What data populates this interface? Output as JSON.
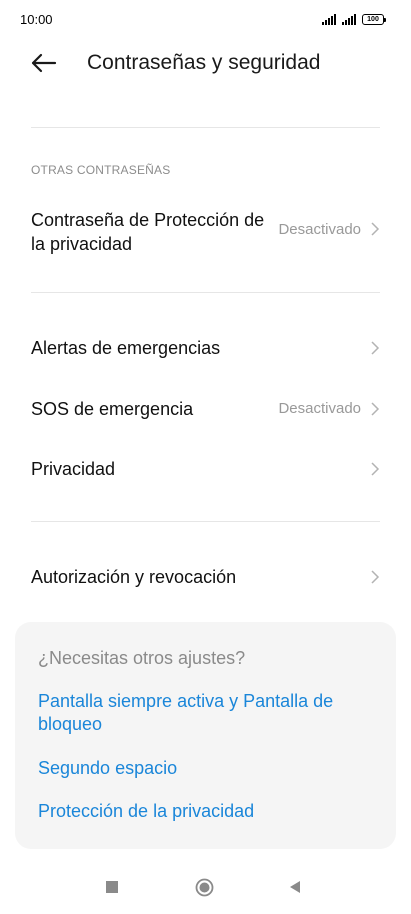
{
  "status_bar": {
    "time": "10:00",
    "battery": "100"
  },
  "header": {
    "title": "Contraseñas y seguridad"
  },
  "section": {
    "label": "OTRAS CONTRASEÑAS"
  },
  "rows": [
    {
      "title": "Contraseña de Protección de la privacidad",
      "value": "Desactivado"
    },
    {
      "title": "Alertas de emergencias",
      "value": ""
    },
    {
      "title": "SOS de emergencia",
      "value": "Desactivado"
    },
    {
      "title": "Privacidad",
      "value": ""
    },
    {
      "title": "Autorización y revocación",
      "value": ""
    }
  ],
  "card": {
    "title": "¿Necesitas otros ajustes?",
    "links": [
      "Pantalla siempre activa y Pantalla de bloqueo",
      "Segundo espacio",
      "Protección de la privacidad"
    ]
  },
  "colors": {
    "link": "#1a86d9",
    "secondary_text": "#999999",
    "card_bg": "#f5f5f5"
  },
  "icons": {
    "back": "arrow-left-icon",
    "chevron": "chevron-right-icon",
    "nav_recent": "square-icon",
    "nav_home": "circle-icon",
    "nav_back": "triangle-left-icon"
  }
}
